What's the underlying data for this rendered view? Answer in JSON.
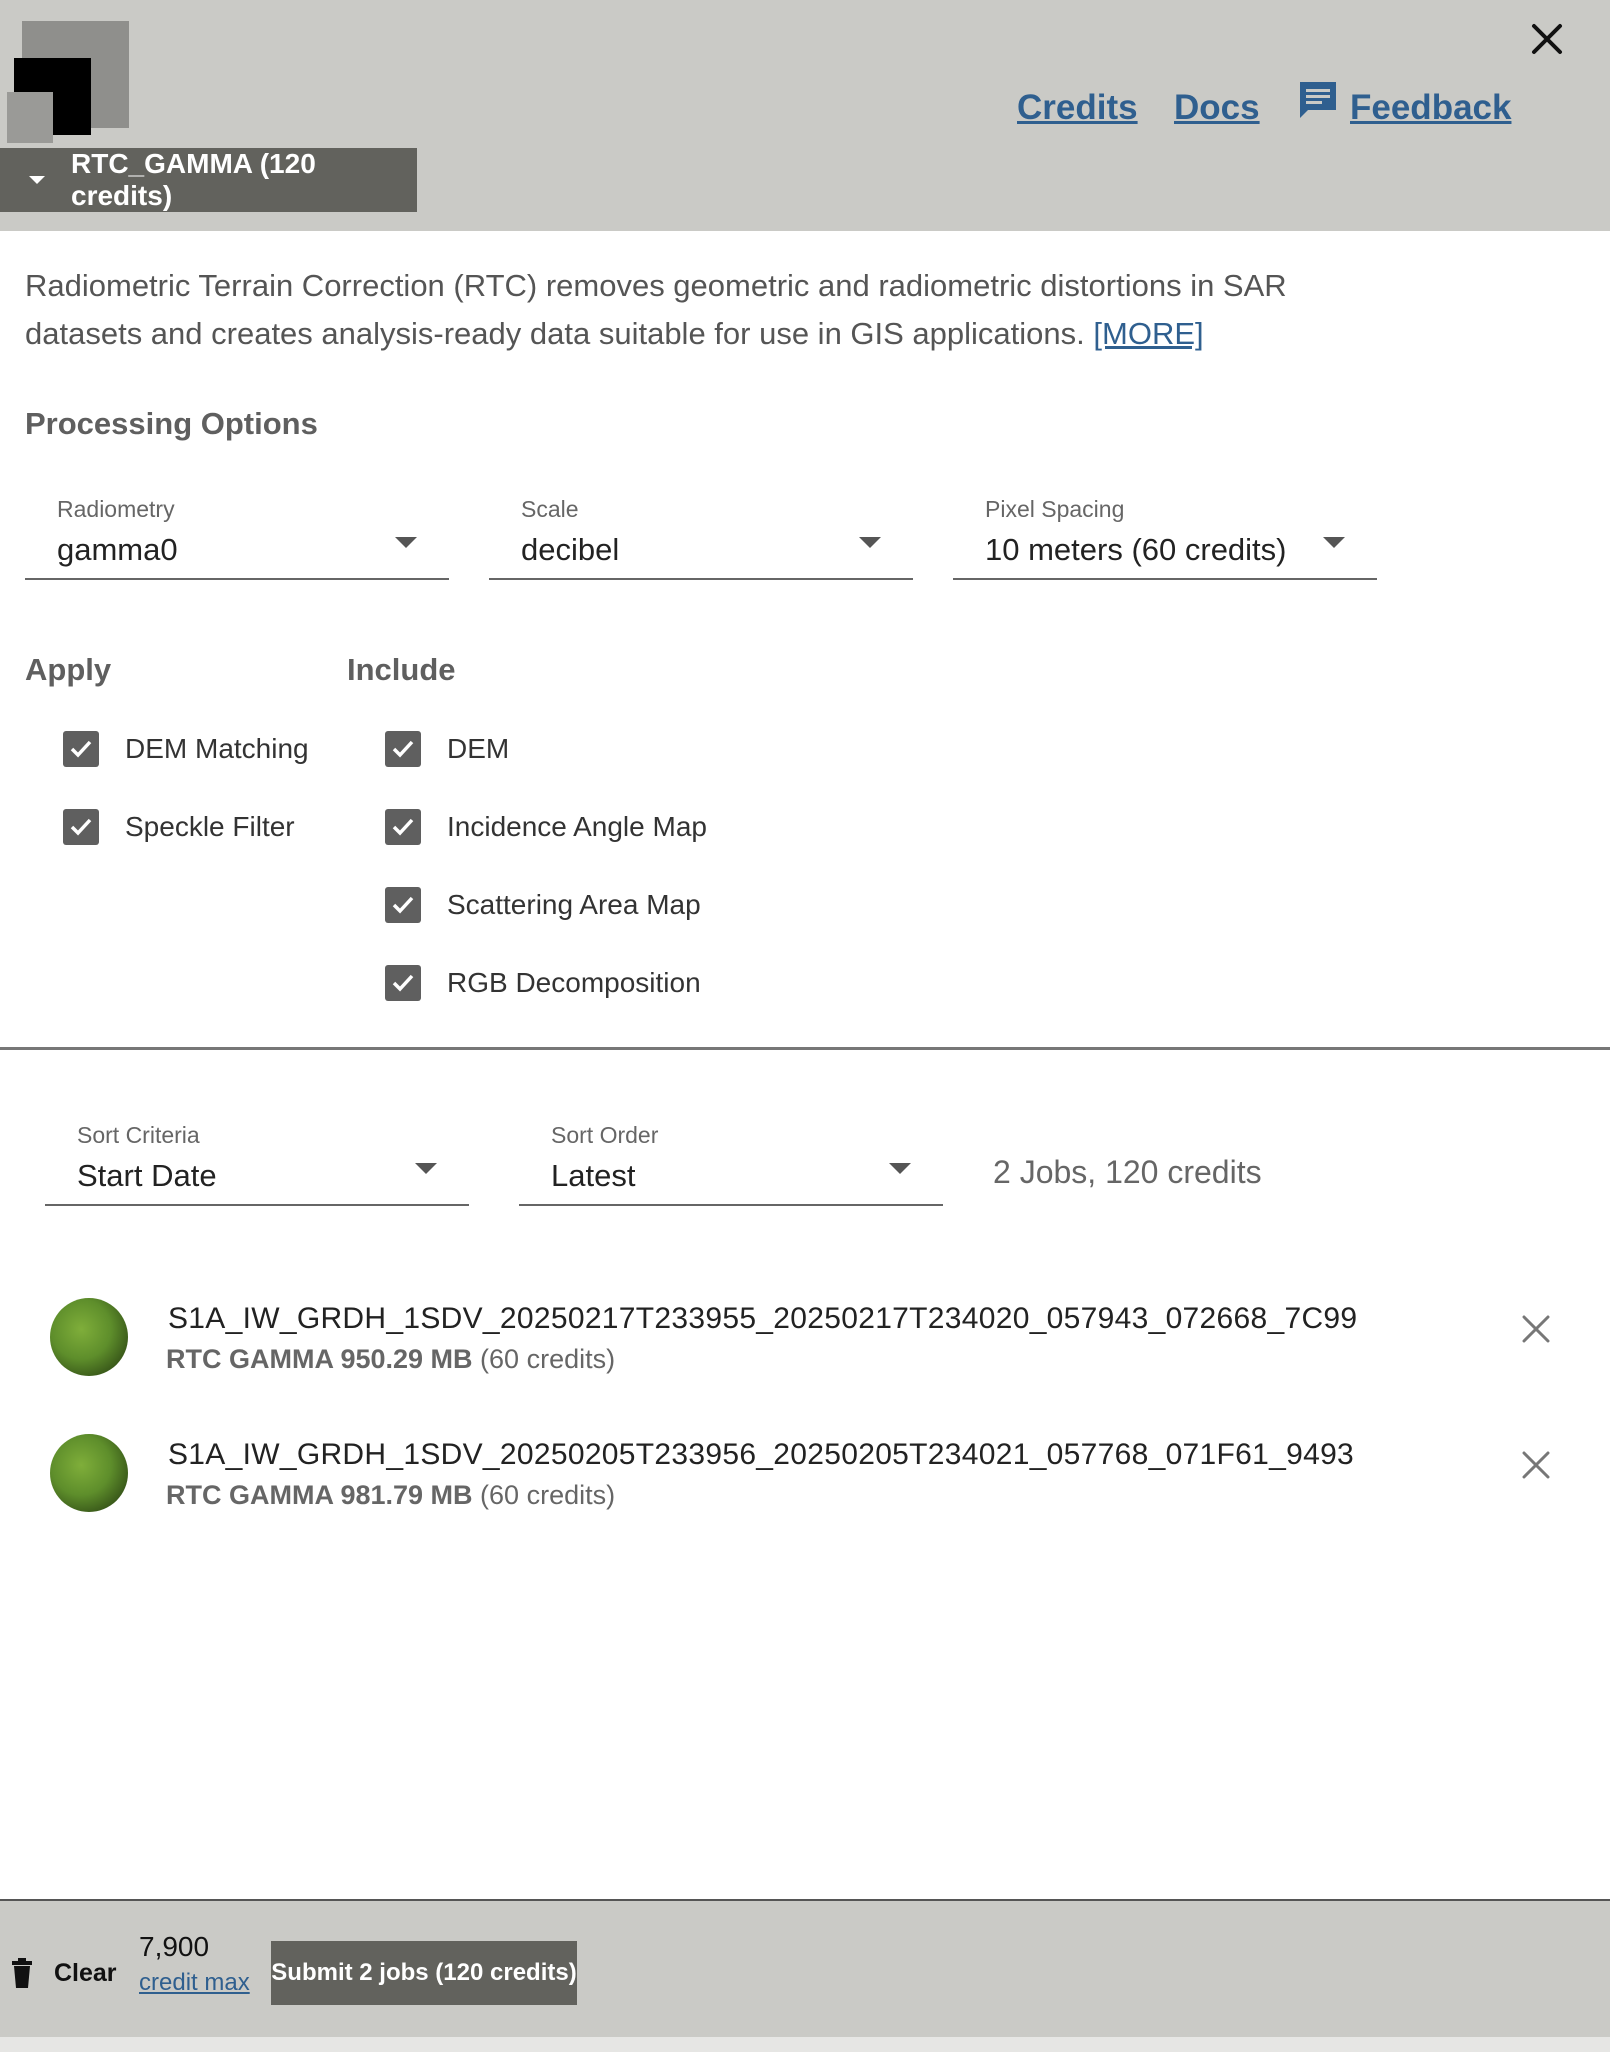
{
  "header": {
    "links": {
      "credits": "Credits",
      "docs": "Docs",
      "feedback": "Feedback"
    },
    "job_type_label": "RTC_GAMMA (120 credits)"
  },
  "description": {
    "text": "Radiometric Terrain Correction (RTC) removes geometric and radiometric distortions in SAR datasets and creates analysis-ready data suitable for use in GIS applications. ",
    "more_link": "[MORE]"
  },
  "processing": {
    "title": "Processing Options",
    "radiometry": {
      "label": "Radiometry",
      "value": "gamma0"
    },
    "scale": {
      "label": "Scale",
      "value": "decibel"
    },
    "pixel_spacing": {
      "label": "Pixel Spacing",
      "value": "10 meters (60 credits)"
    }
  },
  "apply": {
    "title": "Apply",
    "options": [
      {
        "label": "DEM Matching",
        "checked": true
      },
      {
        "label": "Speckle Filter",
        "checked": true
      }
    ]
  },
  "include": {
    "title": "Include",
    "options": [
      {
        "label": "DEM",
        "checked": true
      },
      {
        "label": "Incidence Angle Map",
        "checked": true
      },
      {
        "label": "Scattering Area Map",
        "checked": true
      },
      {
        "label": "RGB Decomposition",
        "checked": true
      }
    ]
  },
  "queue": {
    "sort_criteria": {
      "label": "Sort Criteria",
      "value": "Start Date"
    },
    "sort_order": {
      "label": "Sort Order",
      "value": "Latest"
    },
    "summary": "2 Jobs, 120 credits",
    "jobs": [
      {
        "name": "S1A_IW_GRDH_1SDV_20250217T233955_20250217T234020_057943_072668_7C99",
        "type_size": "RTC GAMMA 950.29 MB",
        "credits": " (60 credits)"
      },
      {
        "name": "S1A_IW_GRDH_1SDV_20250205T233956_20250205T234021_057768_071F61_9493",
        "type_size": "RTC GAMMA 981.79 MB",
        "credits": " (60 credits)"
      }
    ]
  },
  "footer": {
    "clear_label": "Clear",
    "credit_max_value": "7,900",
    "credit_max_link": "credit max",
    "submit_label": "Submit 2 jobs (120 credits)"
  },
  "colors": {
    "header_bg": "#cacac6",
    "button_bg": "#62625d",
    "link": "#2f5f8f",
    "checkbox": "#5f5f5f"
  }
}
